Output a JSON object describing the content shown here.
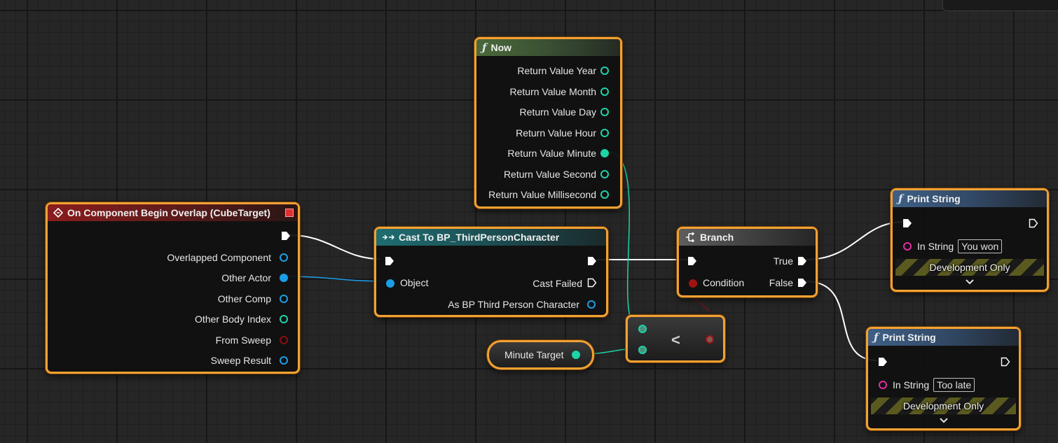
{
  "event_node": {
    "title": "On Component Begin Overlap (CubeTarget)",
    "outputs": [
      "Overlapped Component",
      "Other Actor",
      "Other Comp",
      "Other Body Index",
      "From Sweep",
      "Sweep Result"
    ]
  },
  "now_node": {
    "title": "Now",
    "outputs": [
      "Return Value Year",
      "Return Value Month",
      "Return Value Day",
      "Return Value Hour",
      "Return Value Minute",
      "Return Value Second",
      "Return Value Millisecond"
    ]
  },
  "cast_node": {
    "title": "Cast To BP_ThirdPersonCharacter",
    "object_label": "Object",
    "cast_failed_label": "Cast Failed",
    "as_label": "As BP Third Person Character"
  },
  "branch_node": {
    "title": "Branch",
    "condition_label": "Condition",
    "true_label": "True",
    "false_label": "False"
  },
  "less_node": {
    "operator": "<"
  },
  "minute_target": {
    "label": "Minute Target"
  },
  "print_top": {
    "title": "Print String",
    "in_string_label": "In String",
    "in_string_value": "You won",
    "dev_label": "Development Only"
  },
  "print_bottom": {
    "title": "Print String",
    "in_string_label": "In String",
    "in_string_value": "Too late",
    "dev_label": "Development Only"
  },
  "colors": {
    "selection_border": "#f2a134",
    "exec_wire": "#ffffff",
    "integer_pin": "#1dd3a8",
    "object_pin": "#1b9ee8",
    "bool_pin": "#a11212",
    "string_pin": "#e52ca4"
  }
}
